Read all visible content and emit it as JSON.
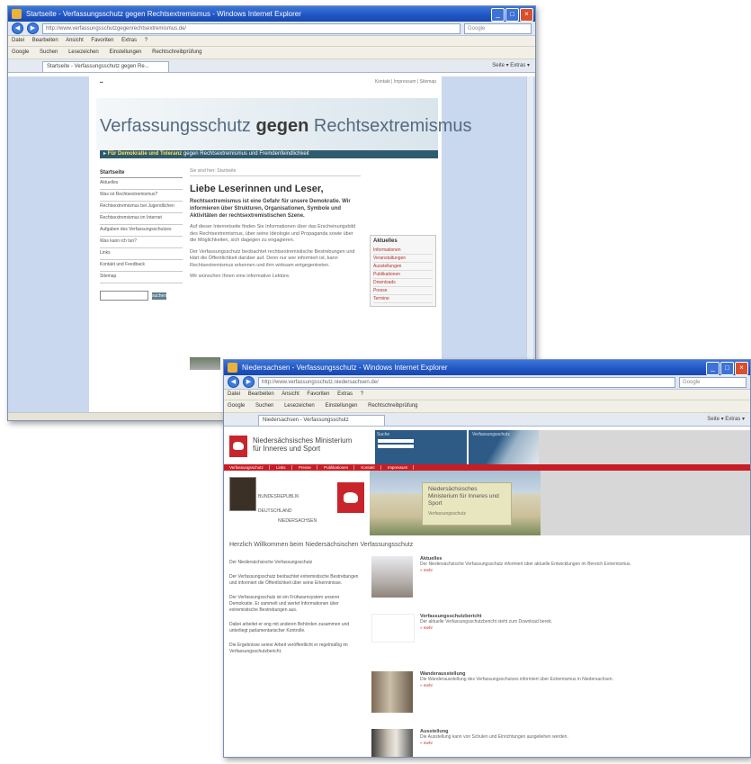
{
  "window1": {
    "title": "Startseite - Verfassungsschutz gegen Rechtsextremismus - Windows Internet Explorer",
    "url": "http://www.verfassungsschutzgegenrechtsextremismus.de/",
    "search_placeholder": "Google",
    "menu": [
      "Datei",
      "Bearbeiten",
      "Ansicht",
      "Favoriten",
      "Extras",
      "?"
    ],
    "links": [
      "Google",
      "Suchen",
      "Lesezeichen",
      "Einstellungen",
      "Rechtschreibprüfung"
    ],
    "tab_label": "Startseite - Verfassungsschutz gegen Re...",
    "tab_tools": "Seite ▾  Extras ▾",
    "page": {
      "top_links": "Kontakt | Impressum | Sitemap",
      "heading_light": "Verfassungsschutz",
      "heading_bold": "gegen",
      "heading_end": "Rechtsextremismus",
      "strip_bold": "Für Demokratie und Toleranz",
      "strip_rest": "gegen Rechtsextremismus und Fremdenfeindlichkeit",
      "nav_head": "Startseite",
      "nav_items": [
        "Aktuelles",
        "Was ist Rechtsextremismus?",
        "Rechtsextremismus bei Jugendlichen",
        "Rechtsextremismus im Internet",
        "Aufgaben des Verfassungsschutzes",
        "Was kann ich tun?",
        "Links",
        "Kontakt und Feedback",
        "Sitemap"
      ],
      "search_button": "suchen",
      "breadcrumb": "Sie sind hier: Startseite",
      "greeting": "Liebe Leserinnen und Leser,",
      "lead": "Rechtsextremismus ist eine Gefahr für unsere Demokratie. Wir informieren über Strukturen, Organisationen, Symbole und Aktivitäten der rechtsextremistischen Szene.",
      "paragraphs": [
        "Auf dieser Internetseite finden Sie Informationen über das Erscheinungsbild des Rechtsextremismus, über seine Ideologie und Propaganda sowie über die Möglichkeiten, sich dagegen zu engagieren.",
        "Der Verfassungsschutz beobachtet rechtsextremistische Bestrebungen und klärt die Öffentlichkeit darüber auf. Denn nur wer informiert ist, kann Rechtsextremismus erkennen und ihm wirksam entgegentreten.",
        "Wir wünschen Ihnen eine informative Lektüre."
      ],
      "box_head": "Aktuelles",
      "box_links": [
        "Informationen",
        "Veranstaltungen",
        "Ausstellungen",
        "Publikationen",
        "Downloads",
        "Presse",
        "Termine"
      ]
    }
  },
  "window2": {
    "title": "Niedersachsen - Verfassungsschutz - Windows Internet Explorer",
    "url": "http://www.verfassungsschutz.niedersachsen.de/",
    "search_placeholder": "Google",
    "menu": [
      "Datei",
      "Bearbeiten",
      "Ansicht",
      "Favoriten",
      "Extras",
      "?"
    ],
    "links": [
      "Google",
      "Suchen",
      "Lesezeichen",
      "Einstellungen",
      "Rechtschreibprüfung"
    ],
    "tab_label": "Niedersachsen - Verfassungsschutz",
    "tab_tools": "Seite ▾  Extras ▾",
    "page": {
      "ministry": "Niedersächsisches Ministerium für Inneres und Sport",
      "login_label": "Suche",
      "photo_label": "Verfassungsschutz",
      "redbar": [
        "Verfassungsschutz",
        "Links",
        "Presse",
        "Publikationen",
        "Kontakt",
        "Impressum"
      ],
      "verf_lines": [
        "BUNDESREPUBLIK",
        "DEUTSCHLAND",
        "NIEDERSACHSEN"
      ],
      "box_title": "Niedersächsisches Ministerium für Inneres und Sport",
      "box_sub": "Verfassungsschutz",
      "welcome": "Herzlich Willkommen beim Niedersächsischen Verfassungsschutz",
      "left_paragraphs": [
        "Der Niedersächsische Verfassungsschutz",
        "Der Verfassungsschutz beobachtet extremistische Bestrebungen und informiert die Öffentlichkeit über seine Erkenntnisse.",
        "Der Verfassungsschutz ist ein Frühwarnsystem unserer Demokratie. Er sammelt und wertet Informationen über extremistische Bestrebungen aus.",
        "Dabei arbeitet er eng mit anderen Behörden zusammen und unterliegt parlamentarischer Kontrolle.",
        "Die Ergebnisse seiner Arbeit veröffentlicht er regelmäßig im Verfassungsschutzbericht."
      ],
      "news": [
        {
          "heading": "Aktuelles",
          "text": "Der Niedersächsische Verfassungsschutz informiert über aktuelle Entwicklungen im Bereich Extremismus.",
          "more": "» mehr"
        },
        {
          "heading": "Verfassungsschutzbericht",
          "text": "Der aktuelle Verfassungsschutzbericht steht zum Download bereit.",
          "more": "» mehr"
        },
        {
          "heading": "Wanderausstellung",
          "text": "Die Wanderausstellung des Verfassungsschutzes informiert über Extremismus in Niedersachsen.",
          "more": "» mehr"
        },
        {
          "heading": "Ausstellung",
          "text": "Die Ausstellung kann von Schulen und Einrichtungen ausgeliehen werden.",
          "more": "» mehr"
        }
      ]
    }
  }
}
